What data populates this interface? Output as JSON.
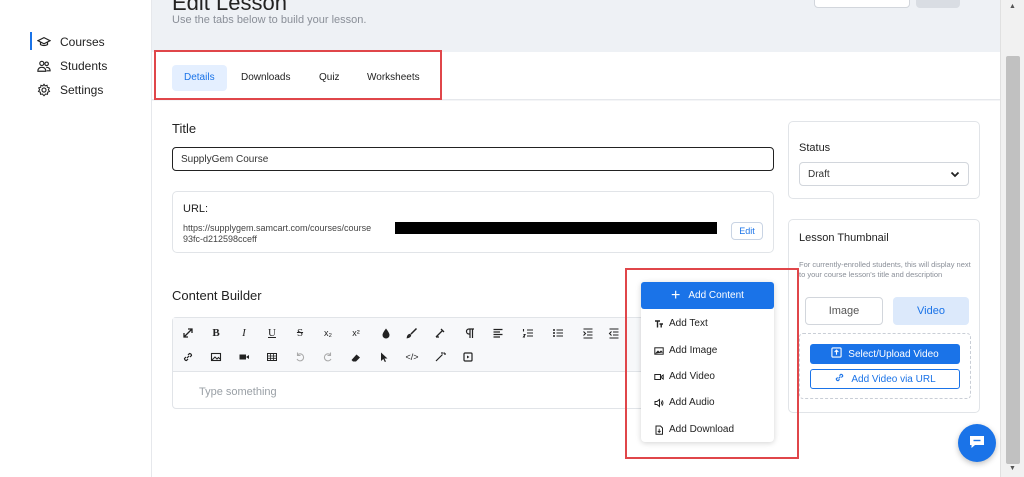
{
  "sidebar": {
    "items": [
      {
        "label": "Courses",
        "icon": "graduation-cap-icon",
        "active": true
      },
      {
        "label": "Students",
        "icon": "users-icon"
      },
      {
        "label": "Settings",
        "icon": "gear-icon"
      }
    ]
  },
  "header": {
    "title": "Edit Lesson",
    "subtitle": "Use the tabs below to build your lesson."
  },
  "tabs": [
    {
      "label": "Details",
      "active": true
    },
    {
      "label": "Downloads"
    },
    {
      "label": "Quiz"
    },
    {
      "label": "Worksheets"
    }
  ],
  "title_section": {
    "label": "Title",
    "value": "SupplyGem Course"
  },
  "url_section": {
    "label": "URL:",
    "line1": "https://supplygem.samcart.com/courses/course",
    "line2": "93fc-d212598cceff",
    "edit_label": "Edit"
  },
  "content_builder": {
    "label": "Content Builder",
    "placeholder": "Type something"
  },
  "status": {
    "label": "Status",
    "value": "Draft"
  },
  "thumbnail": {
    "label": "Lesson Thumbnail",
    "description": "For currently-enrolled students, this will display next to your course lesson's title and description",
    "tab_image": "Image",
    "tab_video": "Video",
    "upload_label": "Select/Upload Video",
    "url_label": "Add Video via URL"
  },
  "add_content_menu": {
    "button_label": "Add Content",
    "items": [
      {
        "label": "Add Text",
        "icon": "text-icon"
      },
      {
        "label": "Add Image",
        "icon": "image-icon"
      },
      {
        "label": "Add Video",
        "icon": "video-icon"
      },
      {
        "label": "Add Audio",
        "icon": "audio-icon"
      },
      {
        "label": "Add Download",
        "icon": "download-file-icon"
      }
    ]
  },
  "toolbar": {
    "row1": [
      "expand-icon",
      "bold-icon",
      "italic-icon",
      "underline-icon",
      "strikethrough-icon",
      "subscript-icon",
      "superscript-icon",
      "color-drop-icon",
      "brush-icon",
      "highlight-icon",
      "paragraph-icon",
      "align-icon",
      "ordered-list-icon",
      "unordered-list-icon",
      "indent-icon",
      "outdent-icon"
    ],
    "row2": [
      "link-icon",
      "image-icon",
      "video-icon",
      "table-icon",
      "undo-icon",
      "redo-icon",
      "eraser-icon",
      "cursor-icon",
      "code-icon",
      "magic-icon",
      "embed-icon"
    ],
    "bold": "B",
    "italic": "I",
    "underline": "U",
    "strike": "S",
    "subscript": "x₂",
    "superscript": "x²",
    "code": "</>"
  },
  "colors": {
    "accent": "#1a73e8",
    "annotation": "#e0464a"
  }
}
